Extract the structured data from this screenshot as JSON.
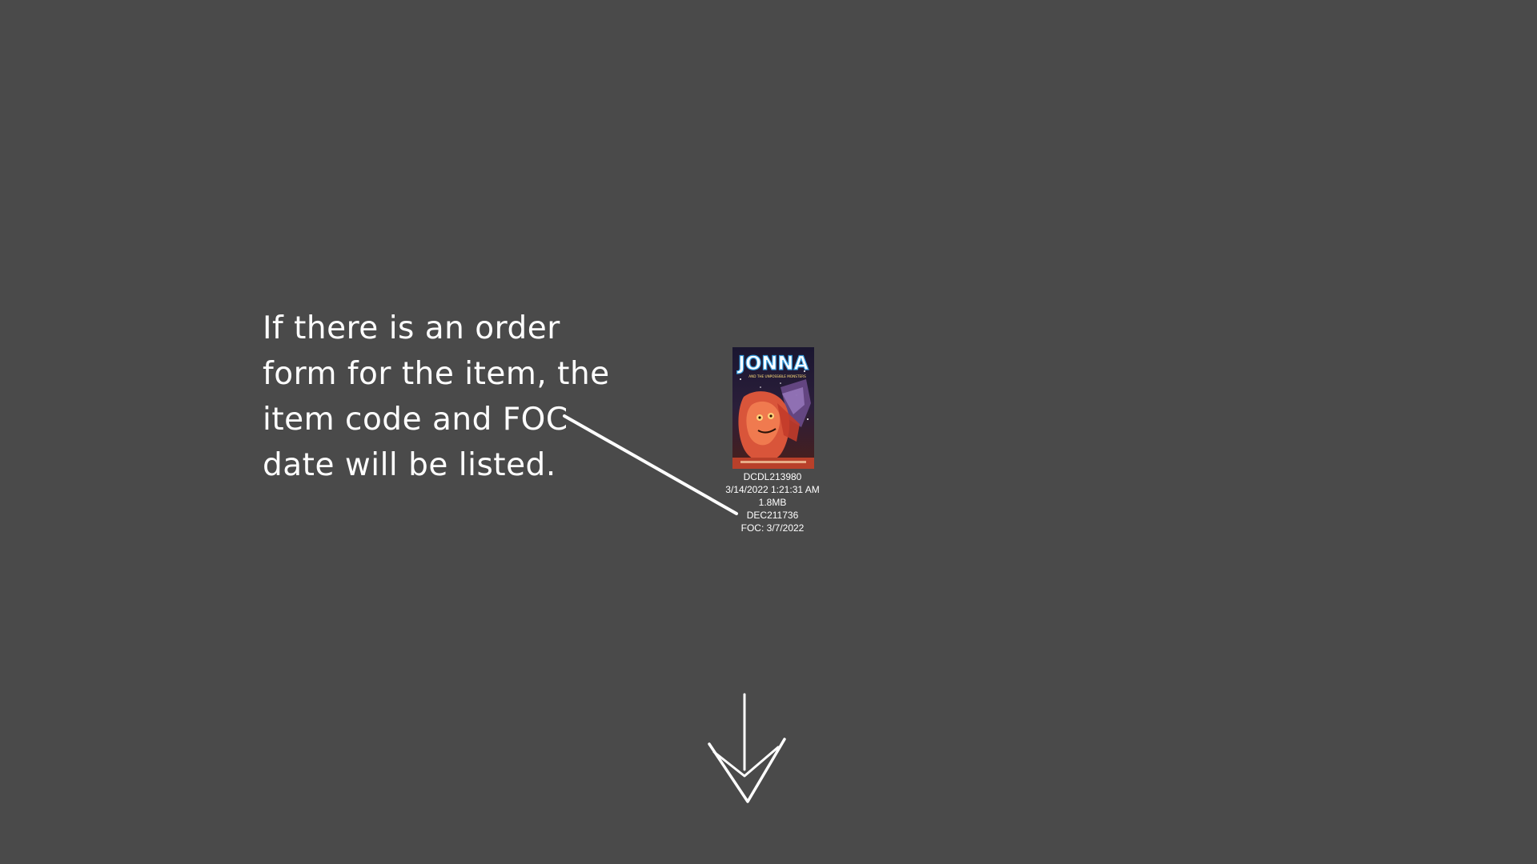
{
  "callout": {
    "line1": "If there is an order",
    "line2": "form for the item, the",
    "line3": "item code and FOC",
    "line4": "date will be listed."
  },
  "file": {
    "name": "DCDL213980",
    "modified": "3/14/2022 1:21:31 AM",
    "size": "1.8MB",
    "item_code": "DEC211736",
    "foc": "FOC: 3/7/2022",
    "cover_title": "JONNA",
    "cover_subtitle": "AND THE UNPOSSIBLE MONSTERS"
  },
  "colors": {
    "background": "#4a4a4a",
    "text": "#ffffff"
  },
  "icons": {
    "pointer_line": "annotation-pointer-line",
    "down_arrow": "arrow-down-icon"
  }
}
